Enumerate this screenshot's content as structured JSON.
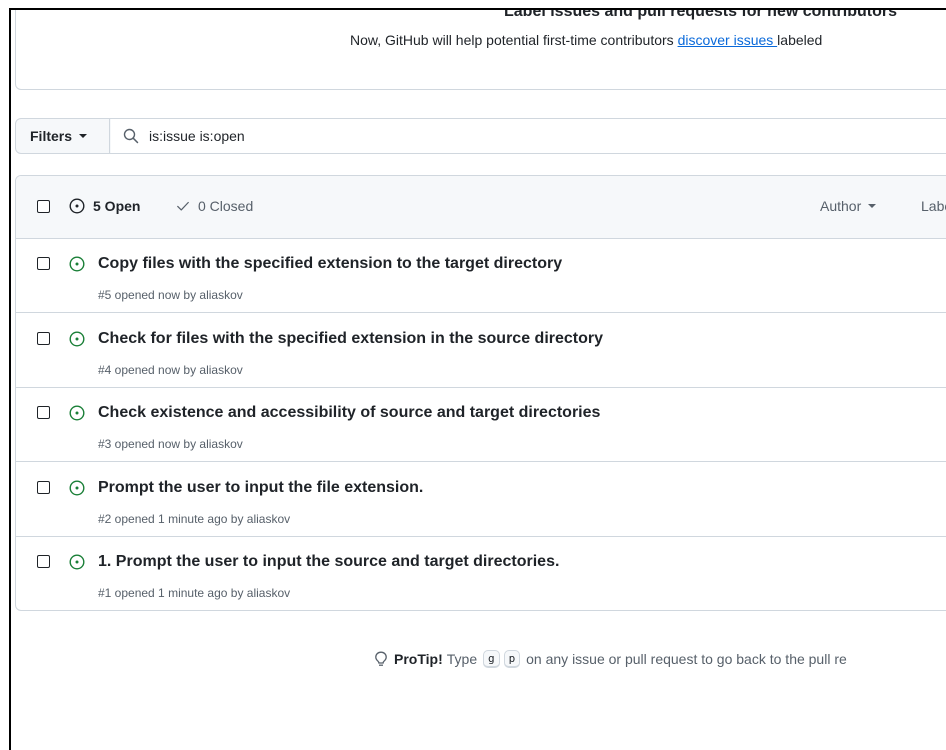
{
  "banner": {
    "title": "Label issues and pull requests for new contributors",
    "text_before": "Now, GitHub will help potential first-time contributors ",
    "link": "discover issues ",
    "text_after": "labeled"
  },
  "filters": {
    "button_label": "Filters",
    "search_value": "is:issue is:open"
  },
  "header": {
    "open_label": "5 Open",
    "closed_label": "0 Closed",
    "author_label": "Author",
    "label_label": "Labe"
  },
  "issues": [
    {
      "title": "Copy files with the specified extension to the target directory",
      "meta": "#5 opened now by aliaskov"
    },
    {
      "title": "Check for files with the specified extension in the source directory",
      "meta": "#4 opened now by aliaskov"
    },
    {
      "title": "Check existence and accessibility of source and target directories",
      "meta": "#3 opened now by aliaskov"
    },
    {
      "title": "Prompt the user to input the file extension.",
      "meta": "#2 opened 1 minute ago by aliaskov"
    },
    {
      "title": "1. Prompt the user to input the source and target directories.",
      "meta": "#1 opened 1 minute ago by aliaskov"
    }
  ],
  "protip": {
    "label": "ProTip!",
    "type_text": "Type",
    "key1": "g",
    "key2": "p",
    "rest": "on any issue or pull request to go back to the pull re"
  },
  "colors": {
    "open_icon": "#1a7f37",
    "link": "#0969da",
    "muted": "#57606a"
  }
}
